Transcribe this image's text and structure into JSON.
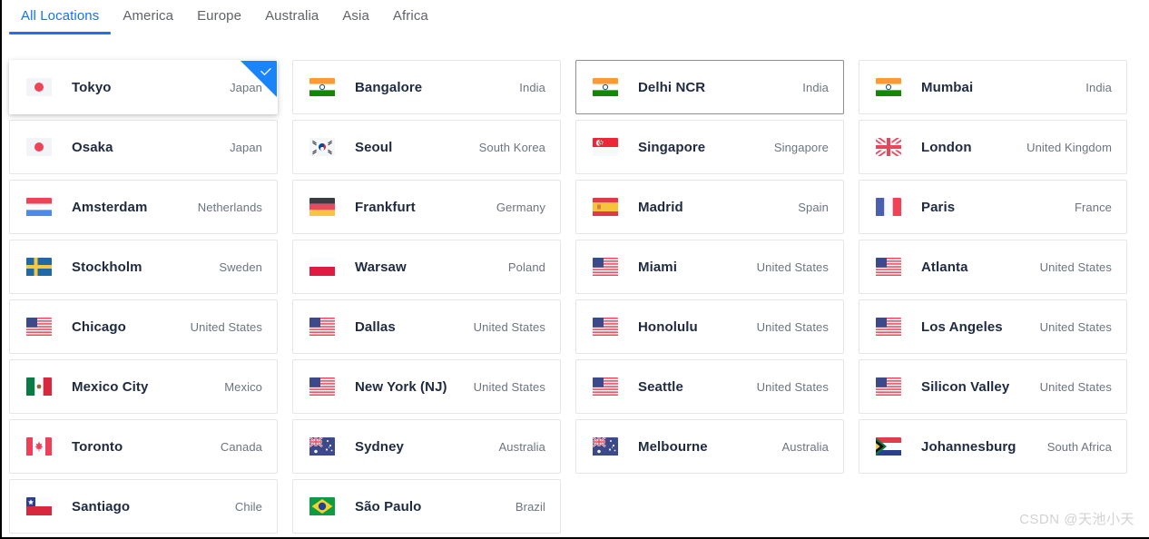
{
  "tabs": [
    {
      "label": "All Locations",
      "active": true
    },
    {
      "label": "America",
      "active": false
    },
    {
      "label": "Europe",
      "active": false
    },
    {
      "label": "Australia",
      "active": false
    },
    {
      "label": "Asia",
      "active": false
    },
    {
      "label": "Africa",
      "active": false
    }
  ],
  "colors": {
    "accent": "#1a73e8",
    "selected_ribbon": "#1a84fb",
    "card_border": "#e4e6ea",
    "card_border_hover": "#8a8f98",
    "city_text": "#1f2a40",
    "country_text": "#6d7480",
    "background": "#ffffff"
  },
  "locations": [
    {
      "city": "Tokyo",
      "country": "Japan",
      "flag": "jp",
      "state": "selected"
    },
    {
      "city": "Bangalore",
      "country": "India",
      "flag": "in",
      "state": "default"
    },
    {
      "city": "Delhi NCR",
      "country": "India",
      "flag": "in",
      "state": "hovered"
    },
    {
      "city": "Mumbai",
      "country": "India",
      "flag": "in",
      "state": "default"
    },
    {
      "city": "Osaka",
      "country": "Japan",
      "flag": "jp",
      "state": "default"
    },
    {
      "city": "Seoul",
      "country": "South Korea",
      "flag": "kr",
      "state": "default"
    },
    {
      "city": "Singapore",
      "country": "Singapore",
      "flag": "sg",
      "state": "default"
    },
    {
      "city": "London",
      "country": "United Kingdom",
      "flag": "gb",
      "state": "default"
    },
    {
      "city": "Amsterdam",
      "country": "Netherlands",
      "flag": "nl",
      "state": "default"
    },
    {
      "city": "Frankfurt",
      "country": "Germany",
      "flag": "de",
      "state": "default"
    },
    {
      "city": "Madrid",
      "country": "Spain",
      "flag": "es",
      "state": "default"
    },
    {
      "city": "Paris",
      "country": "France",
      "flag": "fr",
      "state": "default"
    },
    {
      "city": "Stockholm",
      "country": "Sweden",
      "flag": "se",
      "state": "default"
    },
    {
      "city": "Warsaw",
      "country": "Poland",
      "flag": "pl",
      "state": "default"
    },
    {
      "city": "Miami",
      "country": "United States",
      "flag": "us",
      "state": "default"
    },
    {
      "city": "Atlanta",
      "country": "United States",
      "flag": "us",
      "state": "default"
    },
    {
      "city": "Chicago",
      "country": "United States",
      "flag": "us",
      "state": "default"
    },
    {
      "city": "Dallas",
      "country": "United States",
      "flag": "us",
      "state": "default"
    },
    {
      "city": "Honolulu",
      "country": "United States",
      "flag": "us",
      "state": "default"
    },
    {
      "city": "Los Angeles",
      "country": "United States",
      "flag": "us",
      "state": "default"
    },
    {
      "city": "Mexico City",
      "country": "Mexico",
      "flag": "mx",
      "state": "default"
    },
    {
      "city": "New York (NJ)",
      "country": "United States",
      "flag": "us",
      "state": "default"
    },
    {
      "city": "Seattle",
      "country": "United States",
      "flag": "us",
      "state": "default"
    },
    {
      "city": "Silicon Valley",
      "country": "United States",
      "flag": "us",
      "state": "default"
    },
    {
      "city": "Toronto",
      "country": "Canada",
      "flag": "ca",
      "state": "default"
    },
    {
      "city": "Sydney",
      "country": "Australia",
      "flag": "au",
      "state": "default"
    },
    {
      "city": "Melbourne",
      "country": "Australia",
      "flag": "au",
      "state": "default"
    },
    {
      "city": "Johannesburg",
      "country": "South Africa",
      "flag": "za",
      "state": "default"
    },
    {
      "city": "Santiago",
      "country": "Chile",
      "flag": "cl",
      "state": "default"
    },
    {
      "city": "São Paulo",
      "country": "Brazil",
      "flag": "br",
      "state": "default"
    }
  ],
  "watermark": {
    "text": "CSDN @天池小天"
  }
}
